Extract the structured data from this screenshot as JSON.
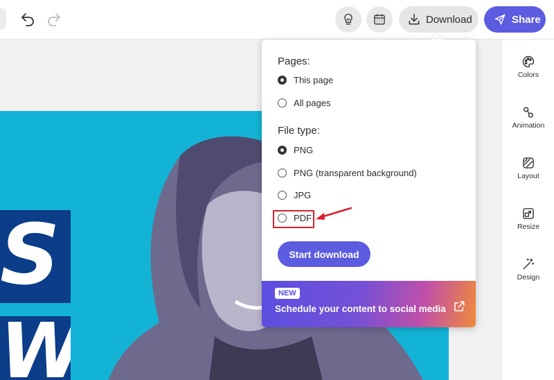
{
  "topbar": {
    "download_label": "Download",
    "share_label": "Share"
  },
  "right_panel": {
    "items": [
      {
        "label": "Colors",
        "icon": "palette-icon"
      },
      {
        "label": "Animation",
        "icon": "animation-icon"
      },
      {
        "label": "Layout",
        "icon": "layout-icon"
      },
      {
        "label": "Resize",
        "icon": "resize-icon"
      },
      {
        "label": "Design",
        "icon": "magic-wand-icon"
      }
    ]
  },
  "download_popup": {
    "pages_title": "Pages:",
    "pages_options": [
      {
        "label": "This page",
        "checked": true
      },
      {
        "label": "All pages",
        "checked": false
      }
    ],
    "filetype_title": "File type:",
    "filetype_options": [
      {
        "label": "PNG",
        "checked": true
      },
      {
        "label": "PNG (transparent background)",
        "checked": false
      },
      {
        "label": "JPG",
        "checked": false
      },
      {
        "label": "PDF",
        "checked": false
      }
    ],
    "start_label": "Start download",
    "promo": {
      "badge": "NEW",
      "text": "Schedule your content to social media"
    }
  },
  "artwork": {
    "block_a": "S",
    "block_b": "W"
  },
  "colors": {
    "accent": "#5c5ce0",
    "canvas_blue": "#13b3d6",
    "navy": "#0b3d89",
    "highlight_red": "#d9202b"
  }
}
